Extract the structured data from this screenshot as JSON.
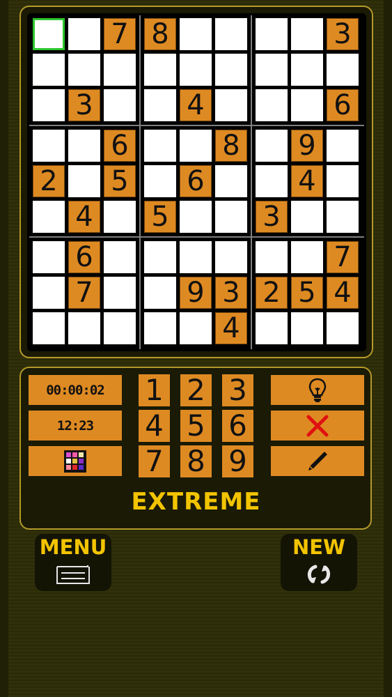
{
  "board": {
    "rows": [
      [
        "",
        "",
        "7",
        "8",
        "",
        "",
        "",
        "",
        "3"
      ],
      [
        "",
        "",
        "",
        "",
        "",
        "",
        "",
        "",
        ""
      ],
      [
        "",
        "3",
        "",
        "",
        "4",
        "",
        "",
        "",
        "6"
      ],
      [
        "",
        "",
        "6",
        "",
        "",
        "8",
        "",
        "9",
        ""
      ],
      [
        "2",
        "",
        "5",
        "",
        "6",
        "",
        "",
        "4",
        ""
      ],
      [
        "",
        "4",
        "",
        "5",
        "",
        "",
        "3",
        "",
        ""
      ],
      [
        "",
        "6",
        "",
        "",
        "",
        "",
        "",
        "",
        "7"
      ],
      [
        "",
        "7",
        "",
        "",
        "9",
        "3",
        "2",
        "5",
        "4"
      ],
      [
        "",
        "",
        "",
        "",
        "",
        "4",
        "",
        "",
        ""
      ]
    ],
    "selected_cell": [
      0,
      0
    ],
    "colors": {
      "given_bg": "#de8a22",
      "empty_bg": "#ffffff",
      "selected_border": "#2ec72e"
    }
  },
  "controls": {
    "timer": "00:00:02",
    "clock": "12:23",
    "color_grid_icon": "color-grid-icon",
    "numbers": [
      "1",
      "2",
      "3",
      "4",
      "5",
      "6",
      "7",
      "8",
      "9"
    ],
    "hint_icon": "lightbulb-icon",
    "erase_icon": "x-icon",
    "pencil_icon": "pencil-icon"
  },
  "difficulty": "EXTREME",
  "nav": {
    "menu_label": "MENU",
    "menu_icon": "menu-icon",
    "new_label": "NEW",
    "new_icon": "refresh-icon"
  },
  "colors": {
    "accent": "#de8a22",
    "title_yellow": "#f2c400",
    "panel_border": "#b49a2a"
  }
}
